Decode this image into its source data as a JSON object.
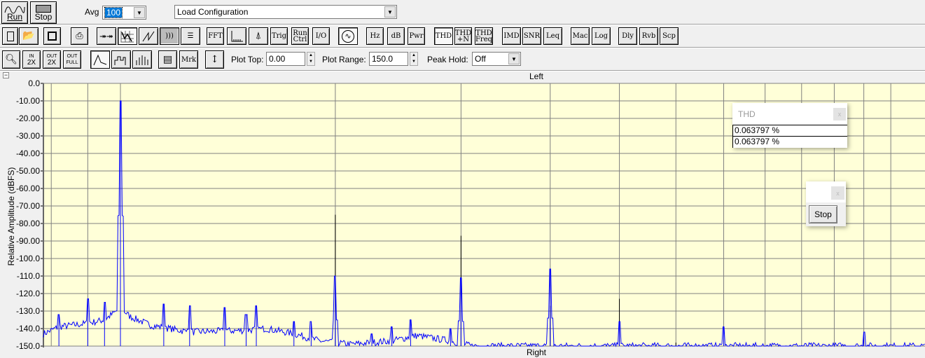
{
  "toolbar1": {
    "run_label": "Run",
    "stop_label": "Stop",
    "avg_label": "Avg",
    "avg_value": "100",
    "config_value": "Load Configuration"
  },
  "toolbar2": {
    "fft": "FFT",
    "trig": "Trig",
    "run_ctrl_1": "Run",
    "run_ctrl_2": "Ctrl",
    "io": "I/O",
    "hz": "Hz",
    "db": "dB",
    "pwr": "Pwr",
    "thd": "THD",
    "thdn_1": "THD",
    "thdn_2": "+N",
    "thdf_1": "THD",
    "thdf_2": "Freq",
    "imd": "IMD",
    "snr": "SNR",
    "leq": "Leq",
    "mac": "Mac",
    "log": "Log",
    "dly": "Dly",
    "rvb": "Rvb",
    "scp": "Scp"
  },
  "toolbar3": {
    "zoom_in_1": "IN",
    "zoom_in_2": "2X",
    "zoom_out_1": "OUT",
    "zoom_out_2": "2X",
    "zoom_full_1": "OUT",
    "zoom_full_2": "FULL",
    "mrk": "Mrk",
    "plot_top_label": "Plot Top:",
    "plot_top_value": "0.00",
    "plot_range_label": "Plot Range:",
    "plot_range_value": "150.0",
    "peak_hold_label": "Peak Hold:",
    "peak_hold_value": "Off"
  },
  "panel": {
    "collapse": "−",
    "channel_top": "Left",
    "channel_bottom": "Right"
  },
  "thd_popup": {
    "title": "THD",
    "close": "x",
    "value1": "0.063797 %",
    "value2": "0.063797 %"
  },
  "stop_popup": {
    "close": "x",
    "stop_label": "Stop"
  },
  "colors": {
    "plot_bg": "#ffffd8",
    "grid": "#808080",
    "trace": "#0000ff",
    "peak": "#000000"
  },
  "chart_data": {
    "type": "line",
    "title": "",
    "ylabel": "Relative Amplitude (dBFS)",
    "xlabel": "",
    "ylim": [
      -150,
      0
    ],
    "x_scale": "log (multiples of fundamental)",
    "xlim": [
      0.78,
      13.4
    ],
    "y_ticks": [
      "0.0",
      "-10.00",
      "-20.00",
      "-30.00",
      "-40.00",
      "-50.00",
      "-60.00",
      "-70.00",
      "-80.00",
      "-90.00",
      "-100.0",
      "-110.0",
      "-120.0",
      "-130.0",
      "-140.0",
      "-150.0"
    ],
    "x_grid": [
      0.8,
      0.9,
      1,
      2,
      3,
      4,
      5,
      6,
      7,
      8,
      9,
      10,
      11,
      12
    ],
    "grid": true,
    "noise_floor": [
      [
        0.78,
        -143
      ],
      [
        0.82,
        -139
      ],
      [
        0.9,
        -137
      ],
      [
        0.95,
        -135
      ],
      [
        0.98,
        -131
      ],
      [
        1.0,
        -128
      ],
      [
        1.03,
        -133
      ],
      [
        1.1,
        -138
      ],
      [
        1.25,
        -142
      ],
      [
        1.5,
        -141
      ],
      [
        1.6,
        -140
      ],
      [
        1.75,
        -143
      ],
      [
        1.9,
        -147
      ],
      [
        2.1,
        -149
      ],
      [
        2.4,
        -147
      ],
      [
        2.6,
        -144
      ],
      [
        2.9,
        -147
      ],
      [
        3.1,
        -150
      ],
      [
        4.0,
        -150
      ],
      [
        13.4,
        -150
      ]
    ],
    "series": [
      {
        "name": "spectrum",
        "peaks": [
          [
            0.82,
            -132
          ],
          [
            0.9,
            -123
          ],
          [
            0.95,
            -125
          ],
          [
            1.0,
            -10
          ],
          [
            1.15,
            -126
          ],
          [
            1.25,
            -127
          ],
          [
            1.4,
            -128
          ],
          [
            1.5,
            -132
          ],
          [
            1.55,
            -127
          ],
          [
            1.75,
            -136
          ],
          [
            1.85,
            -136
          ],
          [
            2.0,
            -110
          ],
          [
            2.25,
            -143
          ],
          [
            2.4,
            -139
          ],
          [
            2.55,
            -135
          ],
          [
            2.9,
            -140
          ],
          [
            3.0,
            -111
          ],
          [
            4.0,
            -106
          ],
          [
            5.0,
            -136
          ],
          [
            7.0,
            -139
          ],
          [
            11.0,
            -142
          ]
        ]
      },
      {
        "name": "peak",
        "peaks": [
          [
            1.0,
            -10
          ],
          [
            2.0,
            -75
          ],
          [
            3.0,
            -87
          ],
          [
            4.0,
            -127
          ],
          [
            5.0,
            -123
          ],
          [
            6.0,
            -148
          ],
          [
            7.0,
            -145
          ],
          [
            11.0,
            -145
          ]
        ]
      }
    ]
  }
}
